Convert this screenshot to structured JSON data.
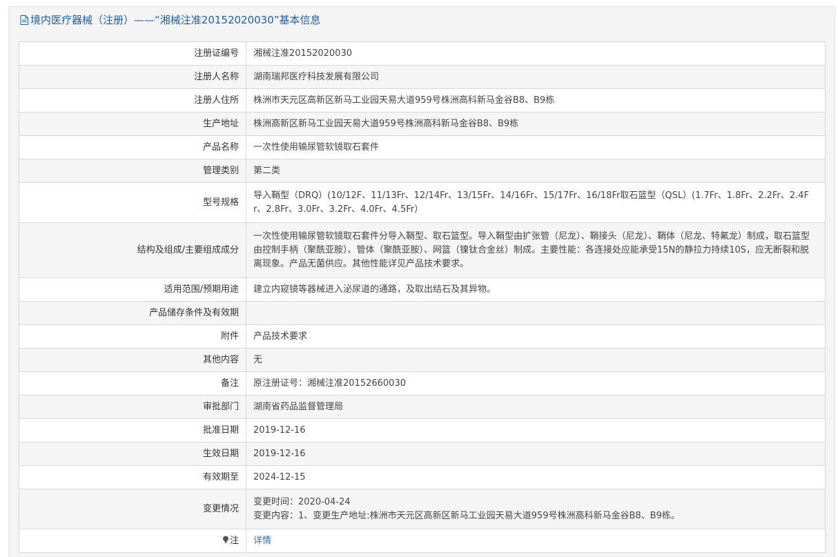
{
  "header": {
    "title": "境内医疗器械（注册）——“湘械注准20152020030”基本信息"
  },
  "rows": [
    {
      "label": "注册证编号",
      "value": "湘械注准20152020030"
    },
    {
      "label": "注册人名称",
      "value": "湖南瑞邦医疗科技发展有限公司"
    },
    {
      "label": "注册人住所",
      "value": "株洲市天元区高新区新马工业园天易大道959号株洲高科新马金谷B8、B9栋"
    },
    {
      "label": "生产地址",
      "value": "株洲高新区新马工业园天易大道959号株洲高科新马金谷B8、B9栋"
    },
    {
      "label": "产品名称",
      "value": "一次性使用输尿管软镜取石套件"
    },
    {
      "label": "管理类别",
      "value": "第二类"
    },
    {
      "label": "型号规格",
      "value": "导入鞘型（DRQ）(10/12F、11/13Fr、12/14Fr、13/15Fr、14/16Fr、15/17Fr、16/18Fr取石篮型（QSL）(1.7Fr、1.8Fr、2.2Fr、2.4Fr、2.8Fr、3.0Fr、3.2Fr、4.0Fr、4.5Fr）"
    },
    {
      "label": "结构及组成/主要组成成分",
      "value": "一次性使用输尿管软镜取石套件分导入鞘型、取石篮型。导入鞘型由扩张管（尼龙）、鞘接头（尼龙）、鞘体（尼龙、特氟龙）制成，取石篮型由控制手柄（聚酰亚胺）、管体（聚酰亚胺）、网篮（镍钛合金丝）制成。主要性能：各连接处应能承受15N的静拉力持续10S，应无断裂和脱离现象。产品无菌供应。其他性能详见产品技术要求。"
    },
    {
      "label": "适用范围/预期用途",
      "value": "建立内窥镜等器械进入泌尿道的通路，及取出结石及其异物。"
    },
    {
      "label": "产品储存条件及有效期",
      "value": ""
    },
    {
      "label": "附件",
      "value": "产品技术要求"
    },
    {
      "label": "其他内容",
      "value": "无"
    },
    {
      "label": "备注",
      "value": "原注册证号：湘械注准20152660030"
    },
    {
      "label": "审批部门",
      "value": "湖南省药品监督管理局"
    },
    {
      "label": "批准日期",
      "value": "2019-12-16"
    },
    {
      "label": "生效日期",
      "value": "2019-12-16"
    },
    {
      "label": "有效期至",
      "value": "2024-12-15"
    }
  ],
  "change": {
    "label": "变更情况",
    "line1": "变更时间：2020-04-24",
    "line2": "变更内容：1、变更生产地址:株洲市天元区高新区新马工业园天易大道959号株洲高科新马金谷B8、B9栋。"
  },
  "note": {
    "label": "注",
    "icon": "pin-icon",
    "link": "详情"
  }
}
